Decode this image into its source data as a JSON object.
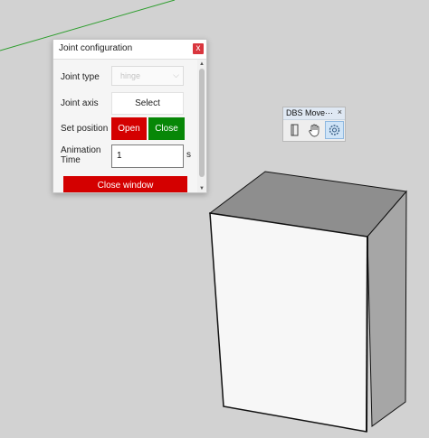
{
  "dialog": {
    "title": "Joint configuration",
    "close_glyph": "x",
    "labels": {
      "joint_type": "Joint type",
      "joint_axis": "Joint axis",
      "set_position": "Set position",
      "animation_time_line1": "Animation",
      "animation_time_line2": "Time"
    },
    "joint_type_value": "hinge",
    "select_label": "Select",
    "open_label": "Open",
    "close_label": "Close",
    "animation_time_value": "1",
    "time_unit": "s",
    "close_window_label": "Close window"
  },
  "toolbar": {
    "title": "DBS Move···",
    "close_glyph": "×",
    "buttons": [
      {
        "icon": "door-panel-icon"
      },
      {
        "icon": "hand-icon"
      },
      {
        "icon": "gear-icon",
        "active": true
      }
    ]
  },
  "colors": {
    "background": "#d2d2d2",
    "red": "#d40000",
    "green": "#078707",
    "axis_green": "#2e9e2e"
  }
}
